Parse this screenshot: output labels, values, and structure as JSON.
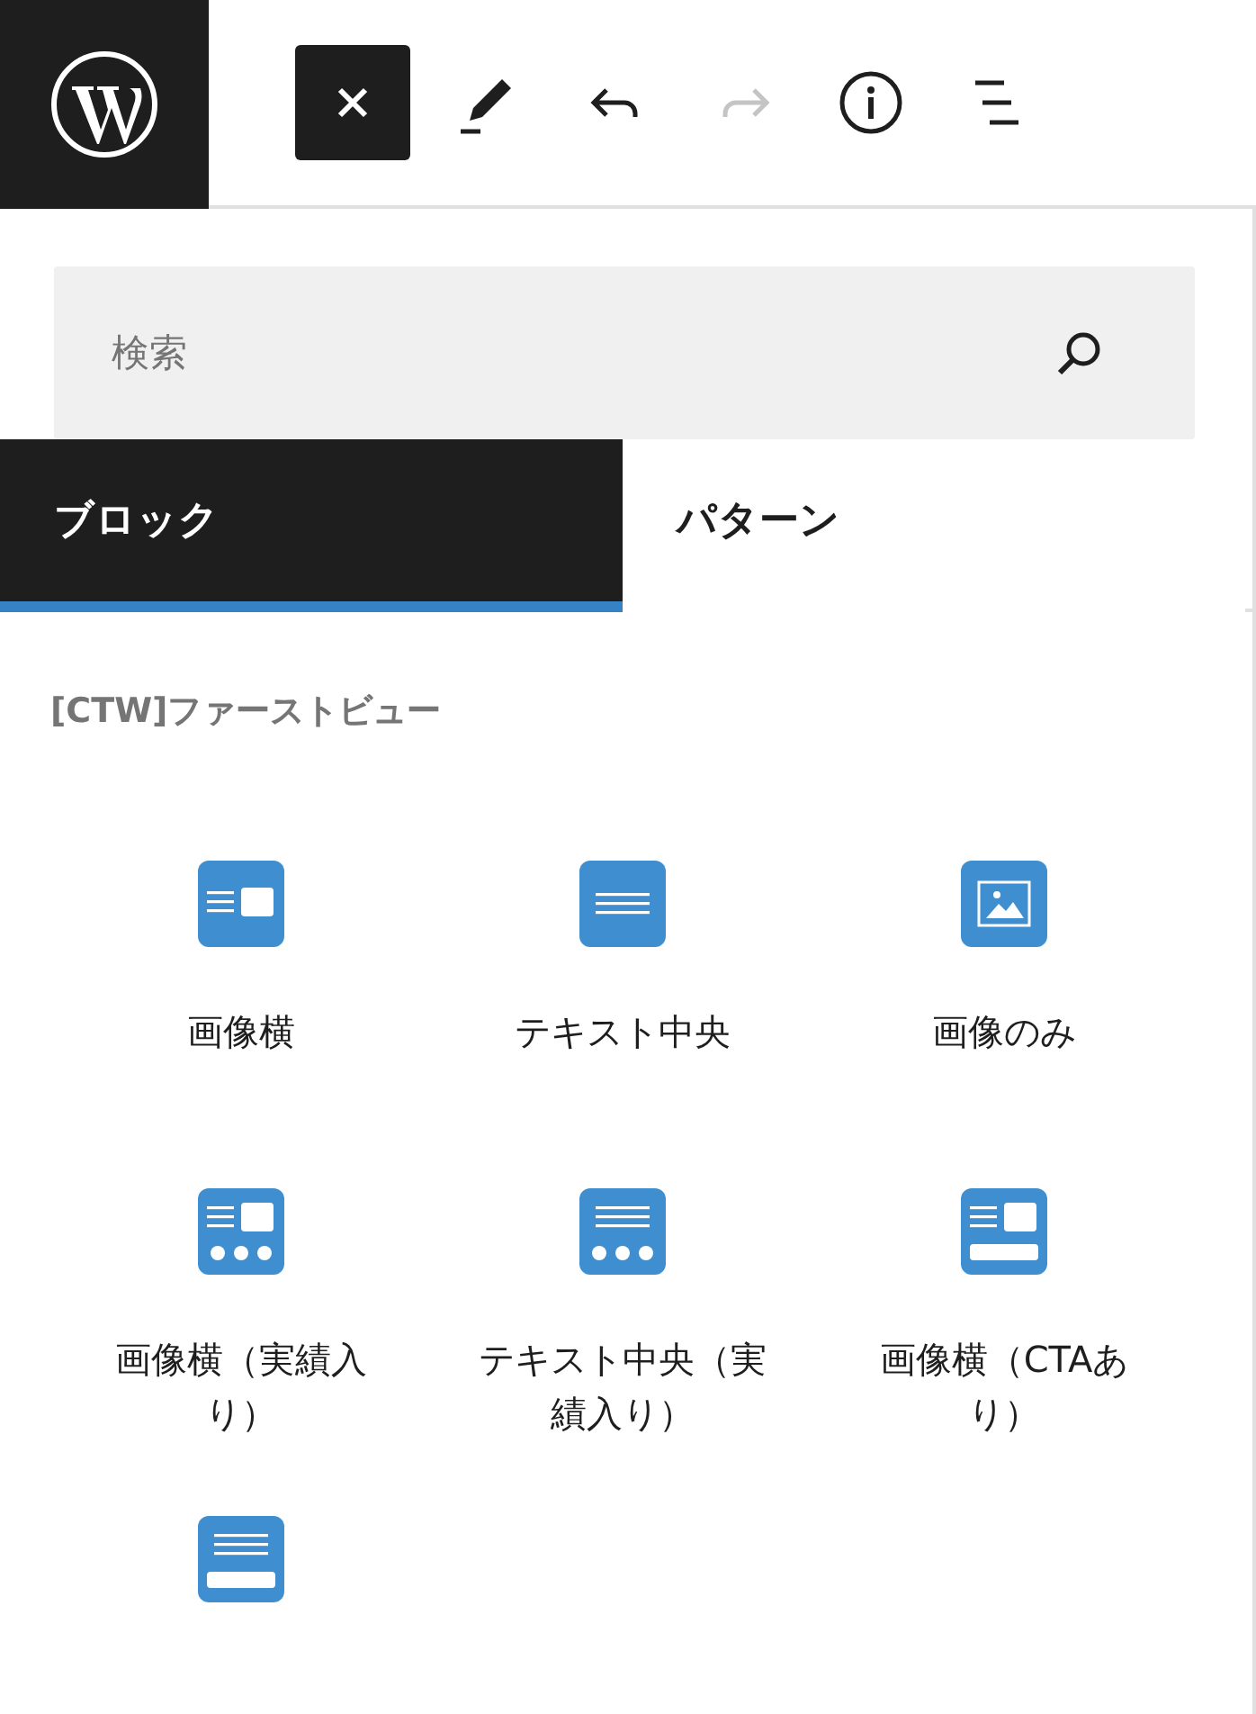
{
  "toolbar": {
    "tools": [
      {
        "kind": "close",
        "pressed": true,
        "disabled": false
      },
      {
        "kind": "edit",
        "pressed": false,
        "disabled": false
      },
      {
        "kind": "undo",
        "pressed": false,
        "disabled": false
      },
      {
        "kind": "redo",
        "pressed": false,
        "disabled": true
      },
      {
        "kind": "info",
        "pressed": false,
        "disabled": false
      },
      {
        "kind": "list",
        "pressed": false,
        "disabled": false
      }
    ]
  },
  "search": {
    "placeholder": "検索"
  },
  "tabs": [
    {
      "label": "ブロック",
      "selected": true
    },
    {
      "label": "パターン",
      "selected": false
    }
  ],
  "category": {
    "title": "[CTW]ファーストビュー",
    "blocks": [
      {
        "kind": "image-side",
        "label": "画像横"
      },
      {
        "kind": "text-center",
        "label": "テキスト中央"
      },
      {
        "kind": "image-only",
        "label": "画像のみ"
      },
      {
        "kind": "image-side-stats",
        "label": "画像横（実績入り）"
      },
      {
        "kind": "text-center-stats",
        "label": "テキスト中央（実績入り）"
      },
      {
        "kind": "image-side-cta",
        "label": "画像横（CTAあり）"
      },
      {
        "kind": "text-center-cta"
      }
    ]
  }
}
